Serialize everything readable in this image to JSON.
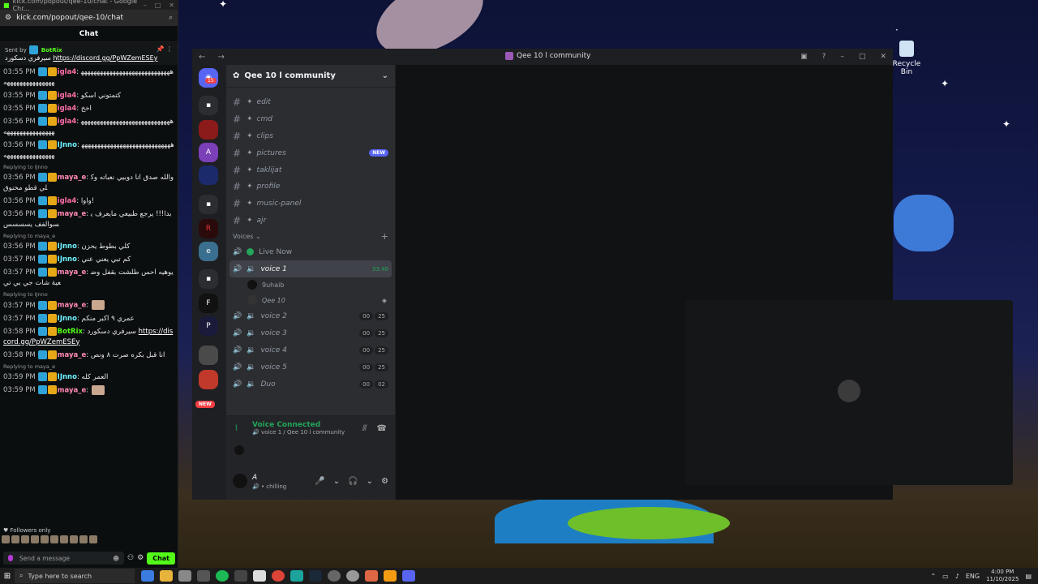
{
  "chat_window": {
    "url": "kick.com/popout/qee-10/chat",
    "tab_title": "kick.com/popout/qee-10/chat - Google Chr...",
    "header": "Chat",
    "pinned": {
      "sent_by": "Sent by",
      "sender": "BotRix",
      "text": "سيرفري دسكورد",
      "link": "https://discord.gg/PpWZemESEy"
    },
    "messages": [
      {
        "time": "03:55 PM",
        "user": "igla4",
        "text": "ههههههههههههههههههههههههههههههههههههههههههههه",
        "color": "pink"
      },
      {
        "time": "03:55 PM",
        "user": "igla4",
        "text": "كتمتوني اسكو",
        "color": "pink"
      },
      {
        "time": "03:55 PM",
        "user": "igla4",
        "text": "اخخ",
        "color": "pink"
      },
      {
        "time": "03:56 PM",
        "user": "igla4",
        "text": "ههههههههههههههههههههههههههههههههههههههههههههه",
        "color": "pink"
      },
      {
        "time": "03:56 PM",
        "user": "IJnno",
        "text": "ههههههههههههههههههههههههههههههههههههههههههههه",
        "color": "cyan"
      },
      {
        "time": "03:56 PM",
        "user": "maya_e",
        "text": "والله صدق انا دوبيي نعباته وكلي قطو مخنوق",
        "color": "rose",
        "reply": "Replying to IJnno"
      },
      {
        "time": "03:56 PM",
        "user": "igla4",
        "text": "واوا!",
        "color": "pink"
      },
      {
        "time": "03:56 PM",
        "user": "maya_e",
        "text": "بدا!!! يرجع طبيعي مايعرف يسوالفف يسسسس",
        "color": "rose"
      },
      {
        "time": "03:56 PM",
        "user": "IJnno",
        "text": "كلي بطوط يحزن",
        "color": "cyan",
        "reply": "Replying to maya_e"
      },
      {
        "time": "03:57 PM",
        "user": "IJnno",
        "text": "كم تبي يعني عني",
        "color": "cyan"
      },
      {
        "time": "03:57 PM",
        "user": "maya_e",
        "text": "يوهيه احس طلشت بقفل وضعية شات جي بي تي",
        "color": "rose"
      },
      {
        "time": "03:57 PM",
        "user": "maya_e",
        "text": "",
        "color": "rose",
        "reply": "Replying to IJnno"
      },
      {
        "time": "03:57 PM",
        "user": "IJnno",
        "text": "عمري ٩ اكبر منكم",
        "color": "cyan"
      },
      {
        "time": "03:58 PM",
        "user": "BotRix",
        "text": "سيرفري دسكورد",
        "color": "green",
        "link": "https://discord.gg/PpWZemESEy"
      },
      {
        "time": "03:58 PM",
        "user": "maya_e",
        "text": "انا قبل بكره صرت ٨ ونص",
        "color": "rose"
      },
      {
        "time": "03:59 PM",
        "user": "IJnno",
        "text": "العمر كله",
        "color": "cyan",
        "reply": "Replying to maya_e"
      },
      {
        "time": "03:59 PM",
        "user": "maya_e",
        "text": "",
        "color": "rose"
      }
    ],
    "followers_only": "Followers only",
    "send_placeholder": "Send a message",
    "chat_button": "Chat"
  },
  "discord": {
    "window_title": "Qee 10 l community",
    "server_name": "Qee 10 l community",
    "home_badge": "15",
    "new_pill": "NEW",
    "text_channels": [
      {
        "name": "edit"
      },
      {
        "name": "cmd"
      },
      {
        "name": "clips"
      },
      {
        "name": "pictures",
        "badge": "NEW"
      },
      {
        "name": "taklijat"
      },
      {
        "name": "profile"
      },
      {
        "name": "music-panel"
      },
      {
        "name": "ajr"
      }
    ],
    "voices_category": "Voices",
    "live_now": "Live Now",
    "active_voice": {
      "name": "voice 1",
      "timer": "33:40"
    },
    "voice_users": [
      "9uhaib",
      "Qee 10"
    ],
    "voice_channels": [
      {
        "name": "voice 2",
        "a": "00",
        "b": "25"
      },
      {
        "name": "voice 3",
        "a": "00",
        "b": "25"
      },
      {
        "name": "voice 4",
        "a": "00",
        "b": "25"
      },
      {
        "name": "voice 5",
        "a": "00",
        "b": "25"
      },
      {
        "name": "Duo",
        "a": "00",
        "b": "02"
      }
    ],
    "voice_connected": "Voice Connected",
    "voice_location": "voice 1 / Qee 10 l community",
    "user_name": "A",
    "user_status": "chilling"
  },
  "desktop": {
    "recycle_bin": "Recycle Bin"
  },
  "taskbar": {
    "search_placeholder": "Type here to search",
    "language": "ENG",
    "time": "4:00 PM",
    "date": "11/10/2025"
  }
}
